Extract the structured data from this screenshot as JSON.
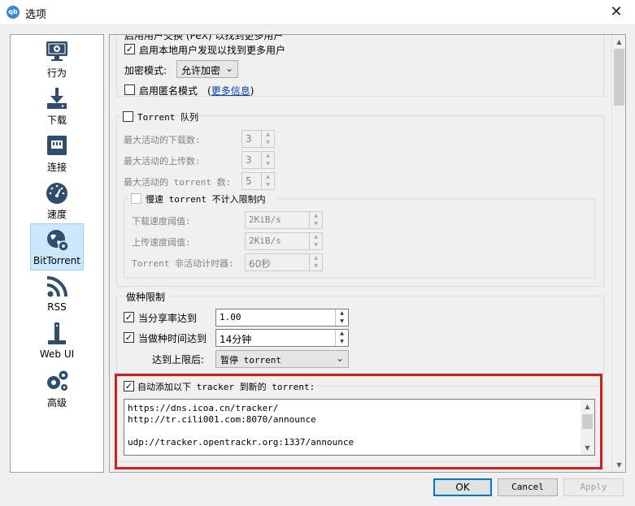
{
  "window": {
    "title": "选项",
    "app_icon_text": "qb"
  },
  "sidebar": {
    "items": [
      {
        "label": "行为",
        "icon": "monitor-gear-icon"
      },
      {
        "label": "下载",
        "icon": "download-icon"
      },
      {
        "label": "连接",
        "icon": "network-icon"
      },
      {
        "label": "速度",
        "icon": "speedometer-icon"
      },
      {
        "label": "BitTorrent",
        "icon": "globe-gear-icon",
        "active": true
      },
      {
        "label": "RSS",
        "icon": "rss-icon"
      },
      {
        "label": "Web UI",
        "icon": "web-ui-icon"
      },
      {
        "label": "高级",
        "icon": "gears-icon"
      }
    ]
  },
  "privacy": {
    "top_partial": "启用用户交换 (PeX) 以找到更多用户",
    "lsd_label": "启用本地用户发现以找到更多用户",
    "lsd_checked": true,
    "encryption_label": "加密模式:",
    "encryption_value": "允许加密",
    "anon_label": "启用匿名模式",
    "anon_checked": false,
    "more_info_prefix": "(",
    "more_info_link": "更多信息",
    "more_info_suffix": ")"
  },
  "queue": {
    "title": "Torrent 队列",
    "checked": false,
    "max_downloads_label": "最大活动的下载数:",
    "max_downloads_value": "3",
    "max_uploads_label": "最大活动的上传数:",
    "max_uploads_value": "3",
    "max_torrents_label": "最大活动的 torrent 数:",
    "max_torrents_value": "5",
    "slow_title": "慢速 torrent 不计入限制内",
    "slow_checked": false,
    "dl_threshold_label": "下载速度阈值:",
    "dl_threshold_value": "2KiB/s",
    "ul_threshold_label": "上传速度阈值:",
    "ul_threshold_value": "2KiB/s",
    "inactivity_label": "Torrent 非活动计时器:",
    "inactivity_value": "60秒"
  },
  "seeding": {
    "title": "做种限制",
    "ratio_label": "当分享率达到",
    "ratio_checked": true,
    "ratio_value": "1.00",
    "time_label": "当做种时间达到",
    "time_checked": true,
    "time_value": "14分钟",
    "action_label": "达到上限后:",
    "action_value": "暂停 torrent"
  },
  "trackers": {
    "label": "自动添加以下 tracker 到新的 torrent:",
    "checked": true,
    "lines": [
      "https://dns.icoa.cn/tracker/",
      "http://tr.cili001.com:8070/announce",
      "",
      "udp://tracker.opentrackr.org:1337/announce"
    ],
    "highlight_color": "#d01f1f"
  },
  "buttons": {
    "ok": "OK",
    "cancel": "Cancel",
    "apply": "Apply"
  }
}
